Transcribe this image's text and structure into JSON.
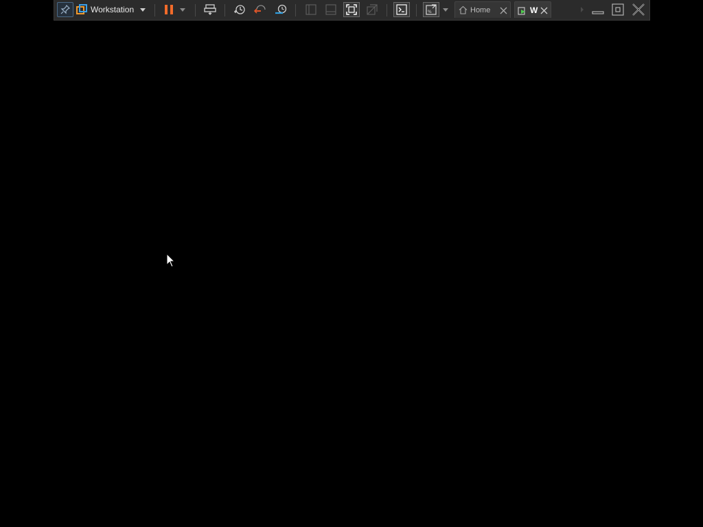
{
  "toolbar": {
    "vm_menu_label": "Workstation",
    "tabs": [
      {
        "label": "Home"
      },
      {
        "label": "W"
      }
    ]
  },
  "colors": {
    "pause_orange": "#f26b2a",
    "accent_blue": "#2f9fe0",
    "background": "#000000"
  },
  "icons": [
    "pin-icon",
    "vm-library-icon",
    "chevron-down-icon",
    "pause-icon",
    "power-dropdown-icon",
    "send-ctrl-alt-del-icon",
    "take-snapshot-icon",
    "revert-snapshot-icon",
    "snapshot-manager-icon",
    "show-library-icon",
    "show-thumbnail-bar-icon",
    "full-screen-icon",
    "unity-icon",
    "console-view-icon",
    "stretch-guest-icon",
    "stretch-dropdown-icon",
    "home-icon",
    "vm-tab-icon",
    "close-icon",
    "scroll-right-icon",
    "minimize-icon",
    "restore-icon",
    "exit-fullscreen-icon",
    "mouse-cursor-icon"
  ]
}
